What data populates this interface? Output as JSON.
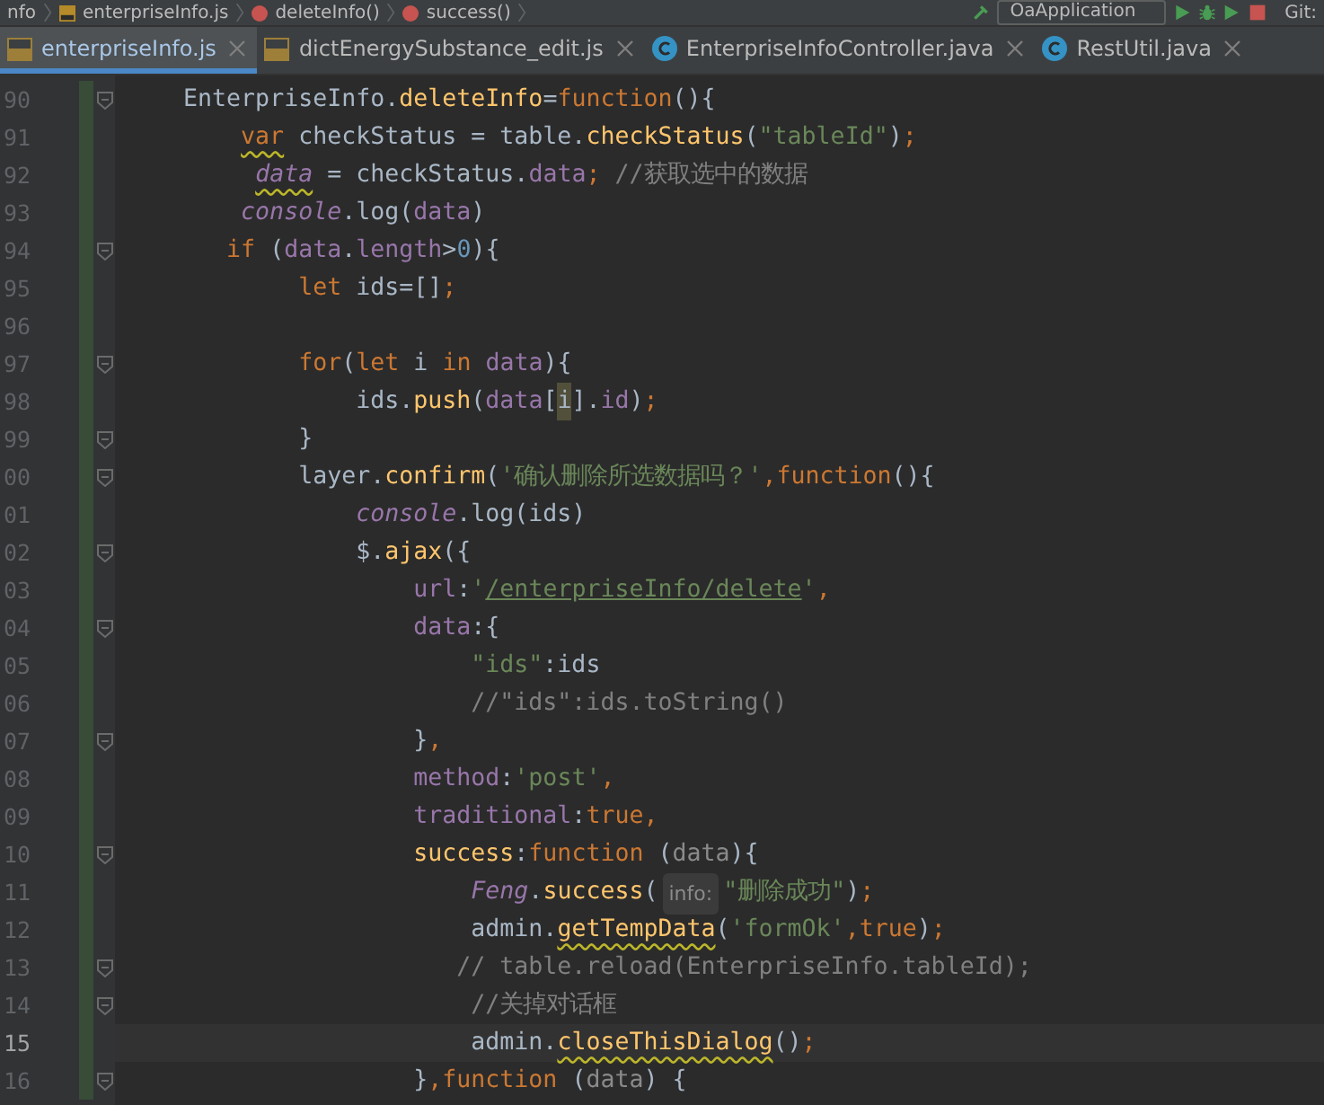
{
  "navigation_bar": {
    "breadcrumbs": [
      {
        "text": "nfo",
        "kind": "folder"
      },
      {
        "text": "enterpriseInfo.js",
        "kind": "js"
      },
      {
        "text": "deleteInfo()",
        "kind": "function"
      },
      {
        "text": "success()",
        "kind": "method"
      }
    ],
    "run_configuration": "OaApplication",
    "vcs_label": "Git:"
  },
  "tabs": [
    {
      "label": "enterpriseInfo.js",
      "kind": "js",
      "selected": true
    },
    {
      "label": "dictEnergySubstance_edit.js",
      "kind": "js",
      "selected": false
    },
    {
      "label": "EnterpriseInfoController.java",
      "kind": "class",
      "selected": false
    },
    {
      "label": "RestUtil.java",
      "kind": "class",
      "selected": false
    }
  ],
  "editor": {
    "lines": [
      {
        "number": "90",
        "current": false,
        "fold": true,
        "tokens": [
          {
            "text": "    EnterpriseInfo.",
            "kind": "id"
          },
          {
            "text": "deleteInfo",
            "kind": "fn"
          },
          {
            "text": "=",
            "kind": "id"
          },
          {
            "text": "function",
            "kind": "kw"
          },
          {
            "text": "(){",
            "kind": "id"
          }
        ]
      },
      {
        "number": "91",
        "current": false,
        "fold": false,
        "tokens": [
          {
            "text": "        var",
            "kind": "kw",
            "warning": true
          },
          {
            "text": " checkStatus = table.",
            "kind": "id"
          },
          {
            "text": "checkStatus",
            "kind": "fn"
          },
          {
            "text": "(",
            "kind": "id"
          },
          {
            "text": "\"tableId\"",
            "kind": "str"
          },
          {
            "text": ")",
            "kind": "id"
          },
          {
            "text": ";",
            "kind": "punct"
          }
        ]
      },
      {
        "number": "92",
        "current": false,
        "fold": false,
        "tokens": [
          {
            "text": "         data",
            "kind": "global",
            "warning": true
          },
          {
            "text": " = checkStatus.",
            "kind": "id"
          },
          {
            "text": "data",
            "kind": "prop"
          },
          {
            "text": ";",
            "kind": "punct"
          },
          {
            "text": " //获取选中的数据",
            "kind": "comment"
          }
        ]
      },
      {
        "number": "93",
        "current": false,
        "fold": false,
        "tokens": [
          {
            "text": "        console",
            "kind": "global"
          },
          {
            "text": ".log(",
            "kind": "id"
          },
          {
            "text": "data",
            "kind": "prop"
          },
          {
            "text": ")",
            "kind": "id"
          }
        ]
      },
      {
        "number": "94",
        "current": false,
        "fold": true,
        "tokens": [
          {
            "text": "       if",
            "kind": "kw"
          },
          {
            "text": " (",
            "kind": "id"
          },
          {
            "text": "data",
            "kind": "prop"
          },
          {
            "text": ".",
            "kind": "id"
          },
          {
            "text": "length",
            "kind": "prop"
          },
          {
            "text": ">",
            "kind": "id"
          },
          {
            "text": "0",
            "kind": "num"
          },
          {
            "text": "){",
            "kind": "id"
          }
        ]
      },
      {
        "number": "95",
        "current": false,
        "fold": false,
        "tokens": [
          {
            "text": "            let",
            "kind": "kw"
          },
          {
            "text": " ids=[]",
            "kind": "id"
          },
          {
            "text": ";",
            "kind": "punct"
          }
        ]
      },
      {
        "number": "96",
        "current": false,
        "fold": false
      },
      {
        "number": "97",
        "current": false,
        "fold": true,
        "tokens": [
          {
            "text": "            for",
            "kind": "kw"
          },
          {
            "text": "(",
            "kind": "id"
          },
          {
            "text": "let",
            "kind": "kw"
          },
          {
            "text": " i ",
            "kind": "id"
          },
          {
            "text": "in",
            "kind": "kw"
          },
          {
            "text": " data",
            "kind": "prop"
          },
          {
            "text": "){",
            "kind": "id"
          }
        ]
      },
      {
        "number": "98",
        "current": false,
        "fold": false,
        "tokens": [
          {
            "text": "                ids.",
            "kind": "id"
          },
          {
            "text": "push",
            "kind": "fn"
          },
          {
            "text": "(",
            "kind": "id"
          },
          {
            "text": "data",
            "kind": "prop"
          },
          {
            "text": "[",
            "kind": "id"
          },
          {
            "text": "i",
            "kind": "id",
            "highlighted": true
          },
          {
            "text": "].",
            "kind": "id"
          },
          {
            "text": "id",
            "kind": "prop"
          },
          {
            "text": ")",
            "kind": "id"
          },
          {
            "text": ";",
            "kind": "punct"
          }
        ]
      },
      {
        "number": "99",
        "current": false,
        "fold": true,
        "tokens": [
          {
            "text": "            }",
            "kind": "id"
          }
        ]
      },
      {
        "number": "00",
        "current": false,
        "fold": true,
        "tokens": [
          {
            "text": "            layer.",
            "kind": "id"
          },
          {
            "text": "confirm",
            "kind": "fn"
          },
          {
            "text": "(",
            "kind": "id"
          },
          {
            "text": "'确认删除所选数据吗？'",
            "kind": "str"
          },
          {
            "text": ",function",
            "kind": "kw"
          },
          {
            "text": "(){",
            "kind": "id"
          }
        ]
      },
      {
        "number": "01",
        "current": false,
        "fold": false,
        "tokens": [
          {
            "text": "                console",
            "kind": "global"
          },
          {
            "text": ".log(ids)",
            "kind": "id"
          }
        ]
      },
      {
        "number": "02",
        "current": false,
        "fold": true,
        "tokens": [
          {
            "text": "                $.",
            "kind": "id"
          },
          {
            "text": "ajax",
            "kind": "fn"
          },
          {
            "text": "({",
            "kind": "id"
          }
        ]
      },
      {
        "number": "03",
        "current": false,
        "fold": false,
        "tokens": [
          {
            "text": "                    url",
            "kind": "prop"
          },
          {
            "text": ":",
            "kind": "id"
          },
          {
            "text": "'",
            "kind": "str"
          },
          {
            "text": "/enterpriseInfo/delete",
            "kind": "str",
            "link": true
          },
          {
            "text": "'",
            "kind": "str"
          },
          {
            "text": ",",
            "kind": "punct"
          }
        ]
      },
      {
        "number": "04",
        "current": false,
        "fold": true,
        "tokens": [
          {
            "text": "                    data",
            "kind": "prop"
          },
          {
            "text": ":{",
            "kind": "id"
          }
        ]
      },
      {
        "number": "05",
        "current": false,
        "fold": false,
        "tokens": [
          {
            "text": "                        \"ids\"",
            "kind": "str"
          },
          {
            "text": ":ids",
            "kind": "id"
          }
        ]
      },
      {
        "number": "06",
        "current": false,
        "fold": false,
        "tokens": [
          {
            "text": "                        //\"ids\":ids.toString()",
            "kind": "comment"
          }
        ]
      },
      {
        "number": "07",
        "current": false,
        "fold": true,
        "tokens": [
          {
            "text": "                    }",
            "kind": "id"
          },
          {
            "text": ",",
            "kind": "punct"
          }
        ]
      },
      {
        "number": "08",
        "current": false,
        "fold": false,
        "tokens": [
          {
            "text": "                    method",
            "kind": "prop"
          },
          {
            "text": ":",
            "kind": "id"
          },
          {
            "text": "'post'",
            "kind": "str"
          },
          {
            "text": ",",
            "kind": "punct"
          }
        ]
      },
      {
        "number": "09",
        "current": false,
        "fold": false,
        "tokens": [
          {
            "text": "                    traditional",
            "kind": "prop"
          },
          {
            "text": ":",
            "kind": "id"
          },
          {
            "text": "true",
            "kind": "kw"
          },
          {
            "text": ",",
            "kind": "punct"
          }
        ]
      },
      {
        "number": "10",
        "current": false,
        "fold": true,
        "tokens": [
          {
            "text": "                    success",
            "kind": "fn"
          },
          {
            "text": ":",
            "kind": "id"
          },
          {
            "text": "function",
            "kind": "kw"
          },
          {
            "text": " (",
            "kind": "id"
          },
          {
            "text": "data",
            "kind": "param"
          },
          {
            "text": "){",
            "kind": "id"
          }
        ]
      },
      {
        "number": "11",
        "current": false,
        "fold": false,
        "tokens": [
          {
            "text": "                        Feng",
            "kind": "global"
          },
          {
            "text": ".",
            "kind": "id"
          },
          {
            "text": "success",
            "kind": "fn"
          },
          {
            "text": "(",
            "kind": "id"
          },
          {
            "text": "info:",
            "kind": "hint"
          },
          {
            "text": "\"删除成功\"",
            "kind": "str"
          },
          {
            "text": ")",
            "kind": "id"
          },
          {
            "text": ";",
            "kind": "punct"
          }
        ]
      },
      {
        "number": "12",
        "current": false,
        "fold": false,
        "tokens": [
          {
            "text": "                        admin.",
            "kind": "id"
          },
          {
            "text": "getTempData",
            "kind": "fn",
            "warning": true
          },
          {
            "text": "(",
            "kind": "id"
          },
          {
            "text": "'formOk'",
            "kind": "str"
          },
          {
            "text": ",",
            "kind": "punct"
          },
          {
            "text": "true",
            "kind": "kw"
          },
          {
            "text": ")",
            "kind": "id"
          },
          {
            "text": ";",
            "kind": "punct"
          }
        ]
      },
      {
        "number": "13",
        "current": false,
        "fold": true,
        "tokens": [
          {
            "text": "                       // table.reload(EnterpriseInfo.tableId);",
            "kind": "comment"
          }
        ]
      },
      {
        "number": "14",
        "current": false,
        "fold": true,
        "tokens": [
          {
            "text": "                        //关掉对话框",
            "kind": "comment"
          }
        ]
      },
      {
        "number": "15",
        "current": true,
        "fold": false,
        "tokens": [
          {
            "text": "                        admin.",
            "kind": "id"
          },
          {
            "text": "closeThisDialog",
            "kind": "fn",
            "warning": true
          },
          {
            "text": "()",
            "kind": "id"
          },
          {
            "text": ";",
            "kind": "punct"
          }
        ]
      },
      {
        "number": "16",
        "current": false,
        "fold": true,
        "tokens": [
          {
            "text": "                    }",
            "kind": "id"
          },
          {
            "text": ",",
            "kind": "punct"
          },
          {
            "text": "function",
            "kind": "kw"
          },
          {
            "text": " (",
            "kind": "id"
          },
          {
            "text": "data",
            "kind": "param"
          },
          {
            "text": ") {",
            "kind": "id"
          }
        ]
      }
    ]
  }
}
